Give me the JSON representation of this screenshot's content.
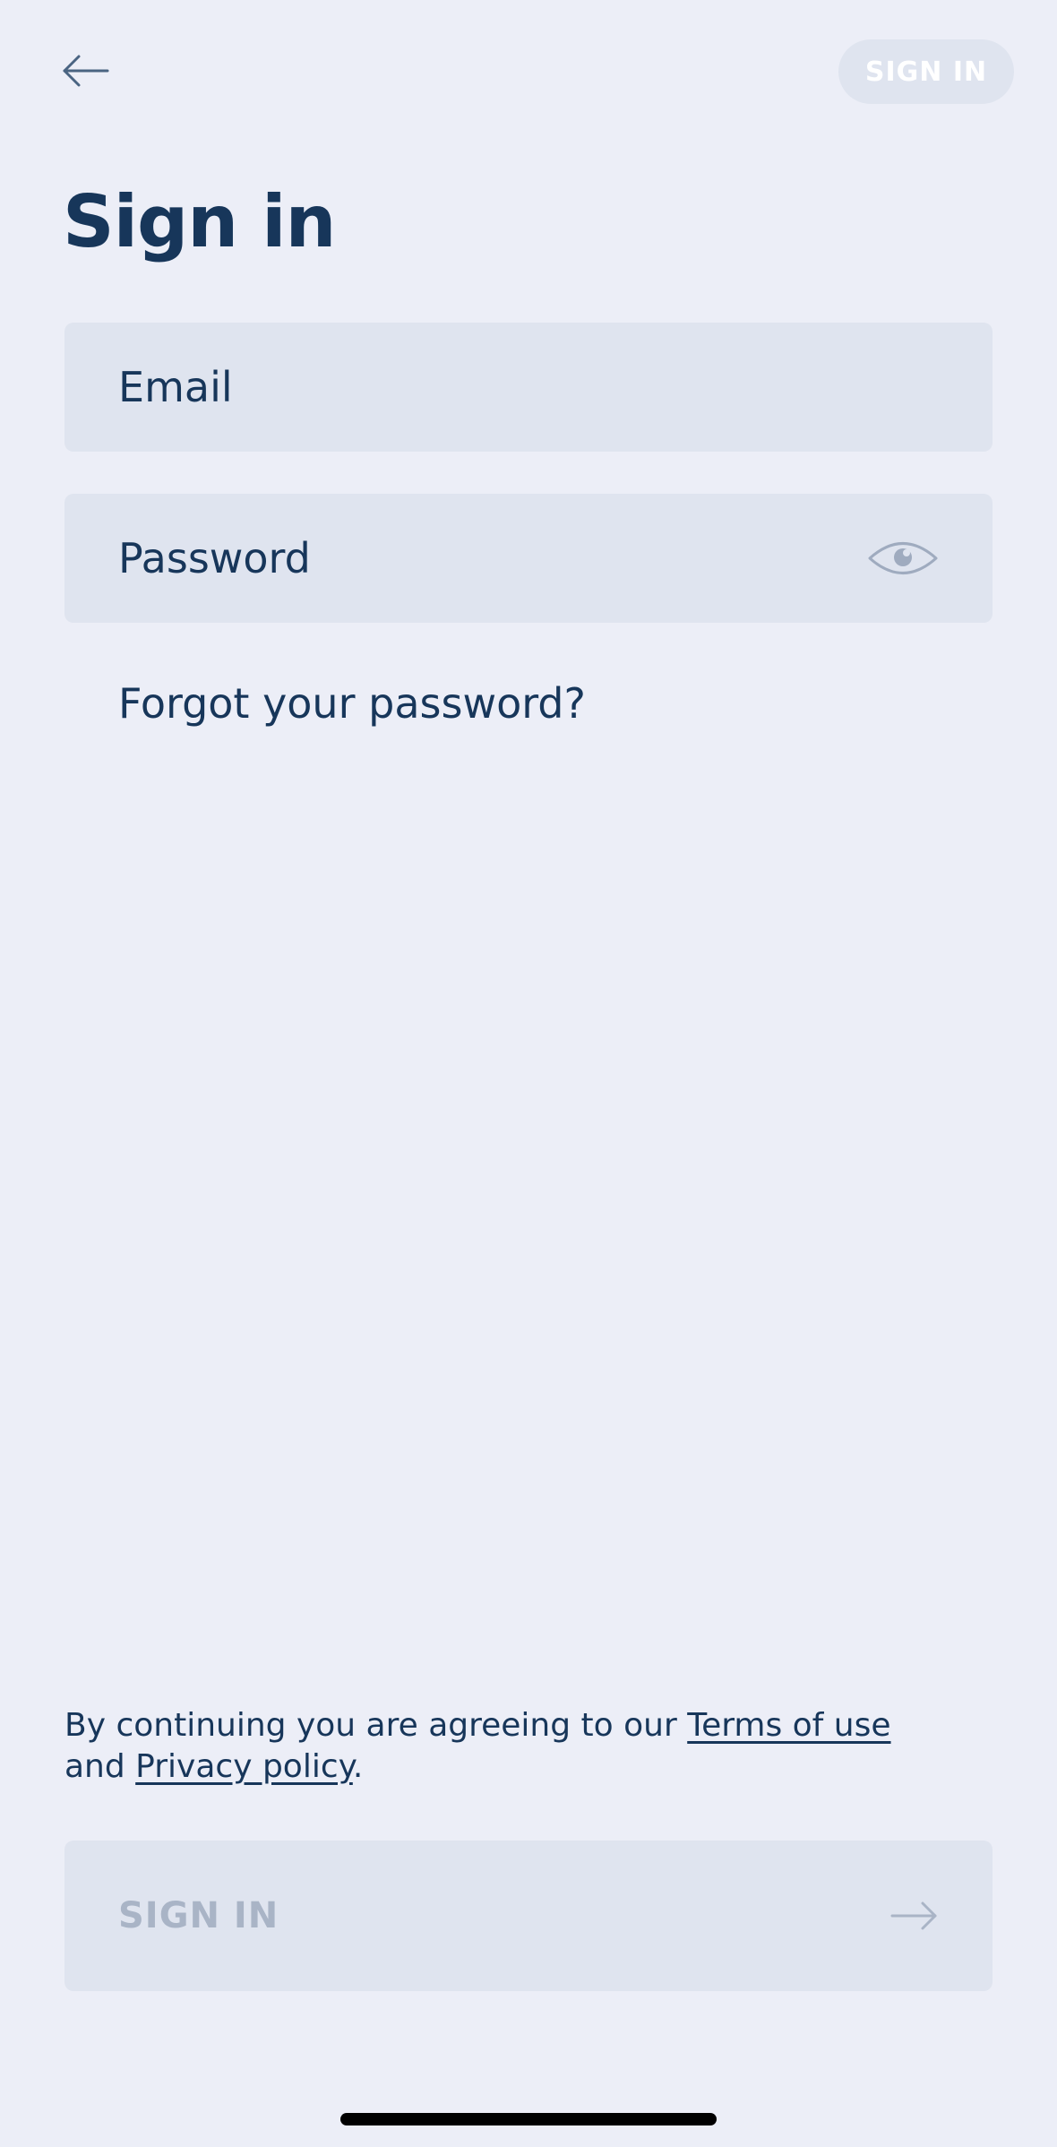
{
  "header": {
    "back_icon": "arrow-left-icon",
    "signin_label": "SIGN IN"
  },
  "title": "Sign in",
  "form": {
    "email_placeholder": "Email",
    "email_value": "",
    "password_placeholder": "Password",
    "password_value": "",
    "password_toggle_icon": "eye-icon",
    "forgot_label": "Forgot your password?"
  },
  "legal": {
    "prefix": "By continuing you are agreeing to our ",
    "terms_label": "Terms of use",
    "middle": " and ",
    "privacy_label": "Privacy policy",
    "suffix": "."
  },
  "submit": {
    "label": "SIGN IN",
    "icon": "arrow-right-icon"
  },
  "colors": {
    "background": "#eceef7",
    "field_background": "#dfe4ef",
    "text_primary": "#17365a",
    "disabled_text": "#a9b4c6"
  }
}
